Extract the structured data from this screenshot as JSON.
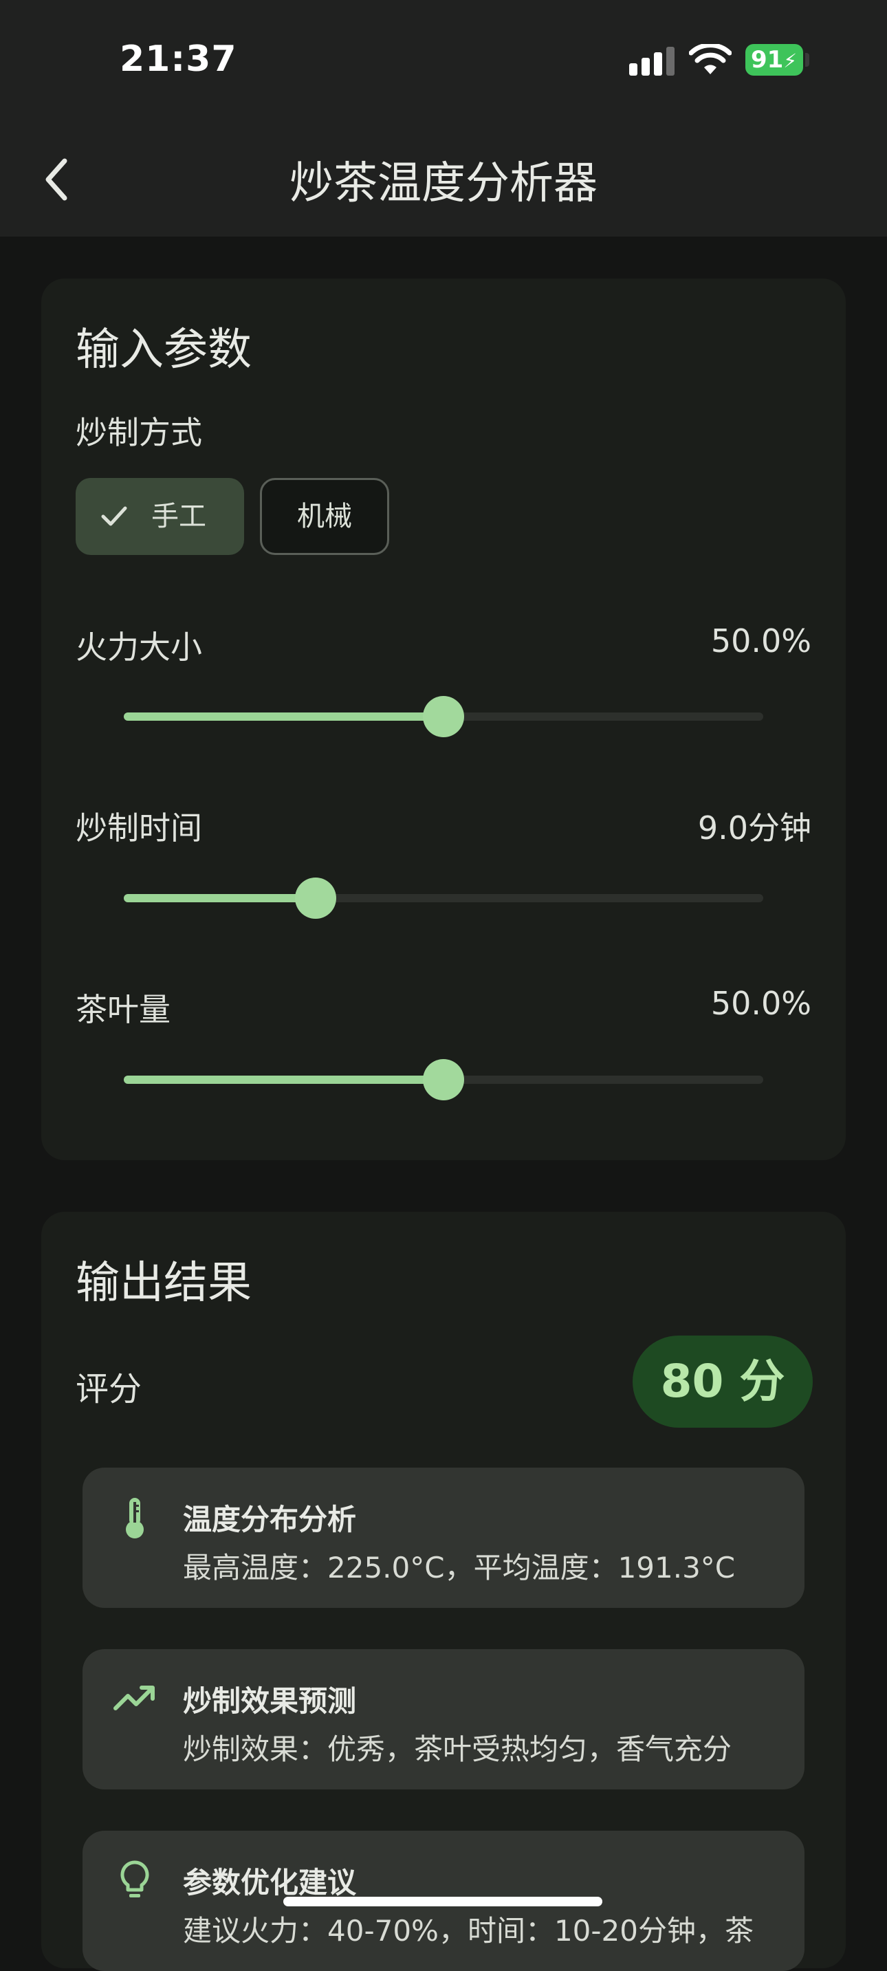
{
  "status_bar": {
    "time": "21:37",
    "battery": "91"
  },
  "app_bar": {
    "title": "炒茶温度分析器"
  },
  "input": {
    "title": "输入参数",
    "method_label": "炒制方式",
    "chips": [
      {
        "label": "手工",
        "selected": true
      },
      {
        "label": "机械",
        "selected": false
      }
    ],
    "sliders": [
      {
        "label": "火力大小",
        "display": "50.0%",
        "fraction": 0.5
      },
      {
        "label": "炒制时间",
        "display": "9.0分钟",
        "fraction": 0.3
      },
      {
        "label": "茶叶量",
        "display": "50.0%",
        "fraction": 0.5
      }
    ]
  },
  "output": {
    "title": "输出结果",
    "score_label": "评分",
    "score": "80 分",
    "items": [
      {
        "icon": "thermometer-icon",
        "title": "温度分布分析",
        "text": "最高温度：225.0°C，平均温度：191.3°C"
      },
      {
        "icon": "trending-up-icon",
        "title": "炒制效果预测",
        "text": "炒制效果：优秀，茶叶受热均匀，香气充分"
      },
      {
        "icon": "lightbulb-icon",
        "title": "参数优化建议",
        "text": "建议火力：40-70%，时间：10-20分钟，茶"
      }
    ]
  },
  "colors": {
    "accent": "#9bd596",
    "score_bg": "#1e4a22",
    "card": "#1b1e1a"
  }
}
